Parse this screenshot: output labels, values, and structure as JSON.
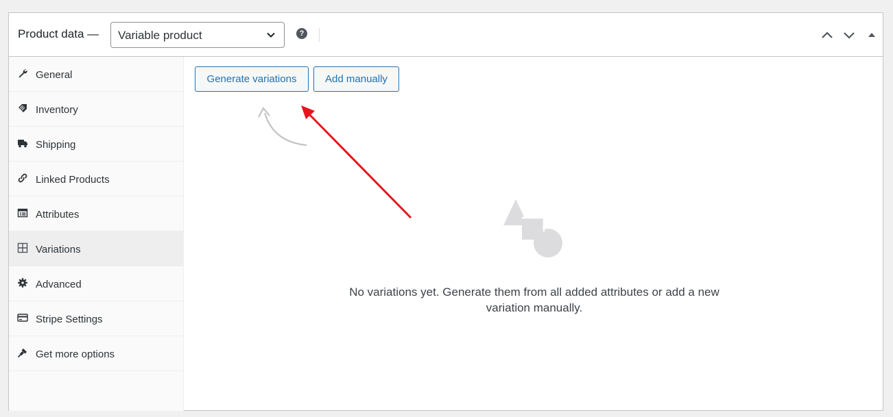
{
  "header": {
    "title": "Product data —",
    "product_type": "Variable product",
    "help_icon": "question-mark-icon",
    "controls": [
      "chevron-up-icon",
      "chevron-down-icon",
      "collapse-triangle-icon"
    ]
  },
  "sidebar": {
    "items": [
      {
        "label": "General",
        "icon": "wrench-icon",
        "active": false
      },
      {
        "label": "Inventory",
        "icon": "tag-icon",
        "active": false
      },
      {
        "label": "Shipping",
        "icon": "truck-icon",
        "active": false
      },
      {
        "label": "Linked Products",
        "icon": "link-icon",
        "active": false
      },
      {
        "label": "Attributes",
        "icon": "list-icon",
        "active": false
      },
      {
        "label": "Variations",
        "icon": "grid-icon",
        "active": true
      },
      {
        "label": "Advanced",
        "icon": "gear-icon",
        "active": false
      },
      {
        "label": "Stripe Settings",
        "icon": "card-icon",
        "active": false
      },
      {
        "label": "Get more options",
        "icon": "plug-icon",
        "active": false
      }
    ]
  },
  "main": {
    "generate_label": "Generate variations",
    "add_manually_label": "Add manually",
    "empty_message": "No variations yet. Generate them from all added attributes or add a new variation manually.",
    "empty_illustration": "shapes-icon"
  },
  "colors": {
    "accent": "#2271b1",
    "annotation_arrow": "#e8141c",
    "active_tab": "#eeeeee",
    "muted_shape": "#dcdcde"
  }
}
